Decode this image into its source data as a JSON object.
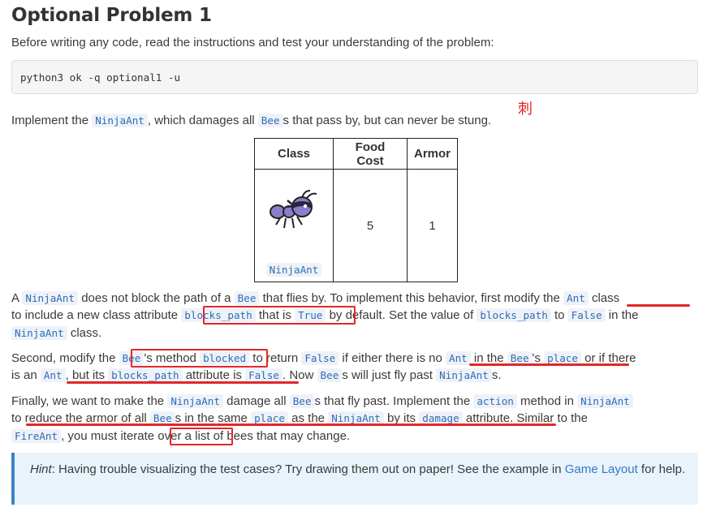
{
  "heading": "Optional Problem 1",
  "intro": "Before writing any code, read the instructions and test your understanding of the problem:",
  "command": "python3 ok -q optional1 -u",
  "annotation_char": "刺",
  "implement": {
    "t1": "Implement the ",
    "c1": "NinjaAnt",
    "t2": ", which damages all ",
    "c2": "Bee",
    "t3": "s that pass by, but can never be stung."
  },
  "table": {
    "headers": [
      "Class",
      "Food Cost",
      "Armor"
    ],
    "row": {
      "class_label": "NinjaAnt",
      "food_cost": "5",
      "armor": "1"
    }
  },
  "para1": {
    "line1": [
      {
        "t": "A "
      },
      {
        "c": "NinjaAnt"
      },
      {
        "t": " does not block the path of a "
      },
      {
        "c": "Bee"
      },
      {
        "t": " that flies by. To implement this behavior, first modify the "
      },
      {
        "c": "Ant"
      },
      {
        "t": " class"
      }
    ],
    "line2": [
      {
        "t": "to include a new class attribute "
      },
      {
        "c": "blocks_path"
      },
      {
        "t": " that is "
      },
      {
        "c": "True"
      },
      {
        "t": " by default. Set the value of "
      },
      {
        "c": "blocks_path"
      },
      {
        "t": " to "
      },
      {
        "c": "False"
      },
      {
        "t": " in the"
      }
    ],
    "line3": [
      {
        "c": "NinjaAnt"
      },
      {
        "t": " class."
      }
    ]
  },
  "para2": {
    "line1": [
      {
        "t": "Second, modify the "
      },
      {
        "c": "Bee"
      },
      {
        "t": "'s method "
      },
      {
        "c": "blocked"
      },
      {
        "t": " to return "
      },
      {
        "c": "False"
      },
      {
        "t": " if either there is no "
      },
      {
        "c": "Ant"
      },
      {
        "t": " in the "
      },
      {
        "c": "Bee"
      },
      {
        "t": "'s "
      },
      {
        "c": "place"
      },
      {
        "t": " or if there"
      }
    ],
    "line2": [
      {
        "t": "is an "
      },
      {
        "c": "Ant"
      },
      {
        "t": ", but its "
      },
      {
        "c": "blocks_path"
      },
      {
        "t": " attribute is "
      },
      {
        "c": "False"
      },
      {
        "t": ". Now "
      },
      {
        "c": "Bee"
      },
      {
        "t": "s will just fly past "
      },
      {
        "c": "NinjaAnt"
      },
      {
        "t": "s."
      }
    ]
  },
  "para3": {
    "line1": [
      {
        "t": "Finally, we want to make the "
      },
      {
        "c": "NinjaAnt"
      },
      {
        "t": " damage all "
      },
      {
        "c": "Bee"
      },
      {
        "t": "s that fly past. Implement the "
      },
      {
        "c": "action"
      },
      {
        "t": " method in "
      },
      {
        "c": "NinjaAnt"
      }
    ],
    "line2": [
      {
        "t": "to reduce the armor of all "
      },
      {
        "c": "Bee"
      },
      {
        "t": "s in the same "
      },
      {
        "c": "place"
      },
      {
        "t": " as the "
      },
      {
        "c": "NinjaAnt"
      },
      {
        "t": " by its "
      },
      {
        "c": "damage"
      },
      {
        "t": " attribute. Similar to the"
      }
    ],
    "line3": [
      {
        "c": "FireAnt"
      },
      {
        "t": ", you must iterate over a list of bees that may change."
      }
    ]
  },
  "hint": {
    "label": "Hint",
    "text": ": Having trouble visualizing the test cases? Try drawing them out on paper! See the example in ",
    "link": "Game Layout",
    "after": " for help."
  },
  "colors": {
    "annotation": "#e3262a",
    "code": "#2d6db4",
    "hint_bar": "#3c84c6"
  }
}
